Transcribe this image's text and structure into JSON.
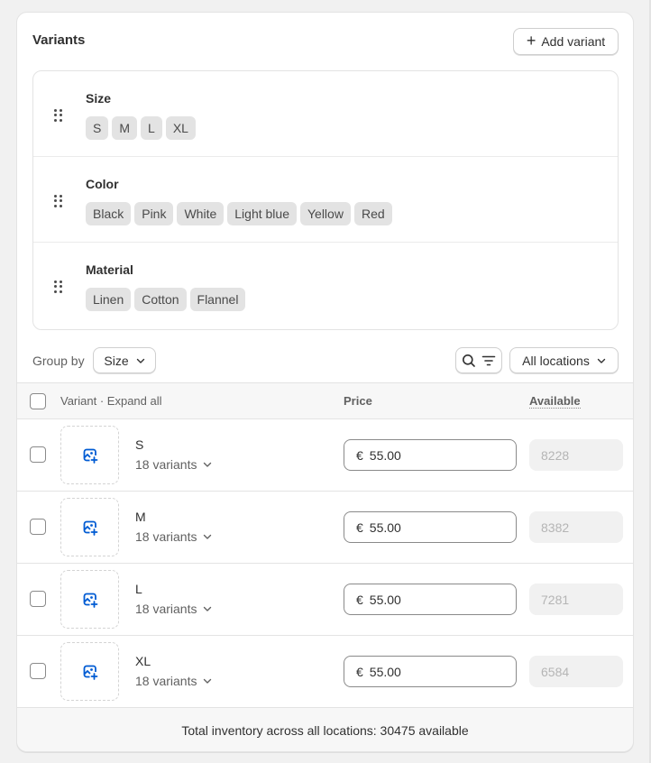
{
  "card": {
    "title": "Variants",
    "add_variant_label": "Add variant"
  },
  "options": [
    {
      "name": "Size",
      "values": [
        "S",
        "M",
        "L",
        "XL"
      ]
    },
    {
      "name": "Color",
      "values": [
        "Black",
        "Pink",
        "White",
        "Light blue",
        "Yellow",
        "Red"
      ]
    },
    {
      "name": "Material",
      "values": [
        "Linen",
        "Cotton",
        "Flannel"
      ]
    }
  ],
  "toolbar": {
    "group_by_label": "Group by",
    "group_by_value": "Size",
    "locations_value": "All locations"
  },
  "table": {
    "headers": {
      "variant": "Variant",
      "separator": " · ",
      "expand_all": "Expand all",
      "price": "Price",
      "available": "Available"
    },
    "rows": [
      {
        "name": "S",
        "count": "18 variants",
        "currency": "€",
        "price": "55.00",
        "available": "8228"
      },
      {
        "name": "M",
        "count": "18 variants",
        "currency": "€",
        "price": "55.00",
        "available": "8382"
      },
      {
        "name": "L",
        "count": "18 variants",
        "currency": "€",
        "price": "55.00",
        "available": "7281"
      },
      {
        "name": "XL",
        "count": "18 variants",
        "currency": "€",
        "price": "55.00",
        "available": "6584"
      }
    ]
  },
  "footer": {
    "total_text": "Total inventory across all locations: 30475 available"
  },
  "colors": {
    "accent_icon": "#005bd3",
    "chip_bg": "#e3e3e3",
    "page_bg": "#f1f1f1"
  }
}
